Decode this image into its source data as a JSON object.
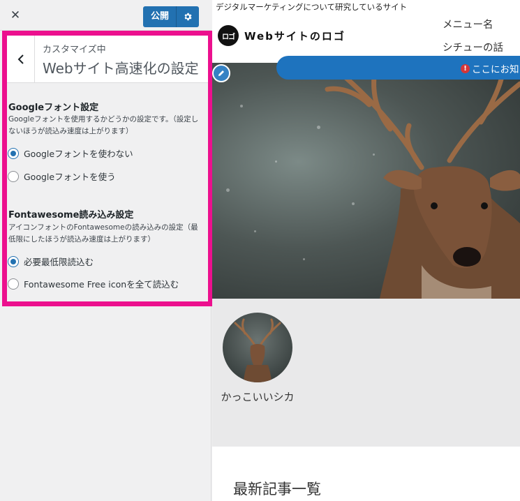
{
  "toolbar": {
    "close_icon": "close-icon",
    "publish_label": "公開",
    "settings_icon": "gear-icon"
  },
  "section": {
    "breadcrumb": "カスタマイズ中",
    "title": "Webサイト高速化の設定",
    "back_icon": "chevron-left-icon"
  },
  "controls": [
    {
      "title": "Googleフォント設定",
      "description": "Googleフォントを使用するかどうかの設定です。（設定しないほうが読込み速度は上がります）",
      "options": [
        {
          "label": "Googleフォントを使わない",
          "checked": true
        },
        {
          "label": "Googleフォントを使う",
          "checked": false
        }
      ]
    },
    {
      "title": "Fontawesome読み込み設定",
      "description": "アイコンフォントのFontawesomeの読み込みの設定（最低限にしたほうが読込み速度は上がります）",
      "options": [
        {
          "label": "必要最低限読込む",
          "checked": true
        },
        {
          "label": "Fontawesome Free iconを全て読込む",
          "checked": false
        }
      ]
    }
  ],
  "colors": {
    "highlight": "#ec108e",
    "accent": "#2271b1",
    "notice_bar": "#1e73be"
  },
  "preview": {
    "tagline": "デジタルマーケティングについて研究しているサイト",
    "logo": {
      "badge": "ロゴ",
      "text": "Webサイトのロゴ"
    },
    "menu": [
      "メニュー名",
      "シチューの話"
    ],
    "notice": "ここにお知",
    "edit_icon": "pencil-icon",
    "hero_alt": "deer-in-snow-image",
    "card": {
      "name": "かっこいいシカ"
    },
    "latest_title": "最新記事一覧"
  }
}
